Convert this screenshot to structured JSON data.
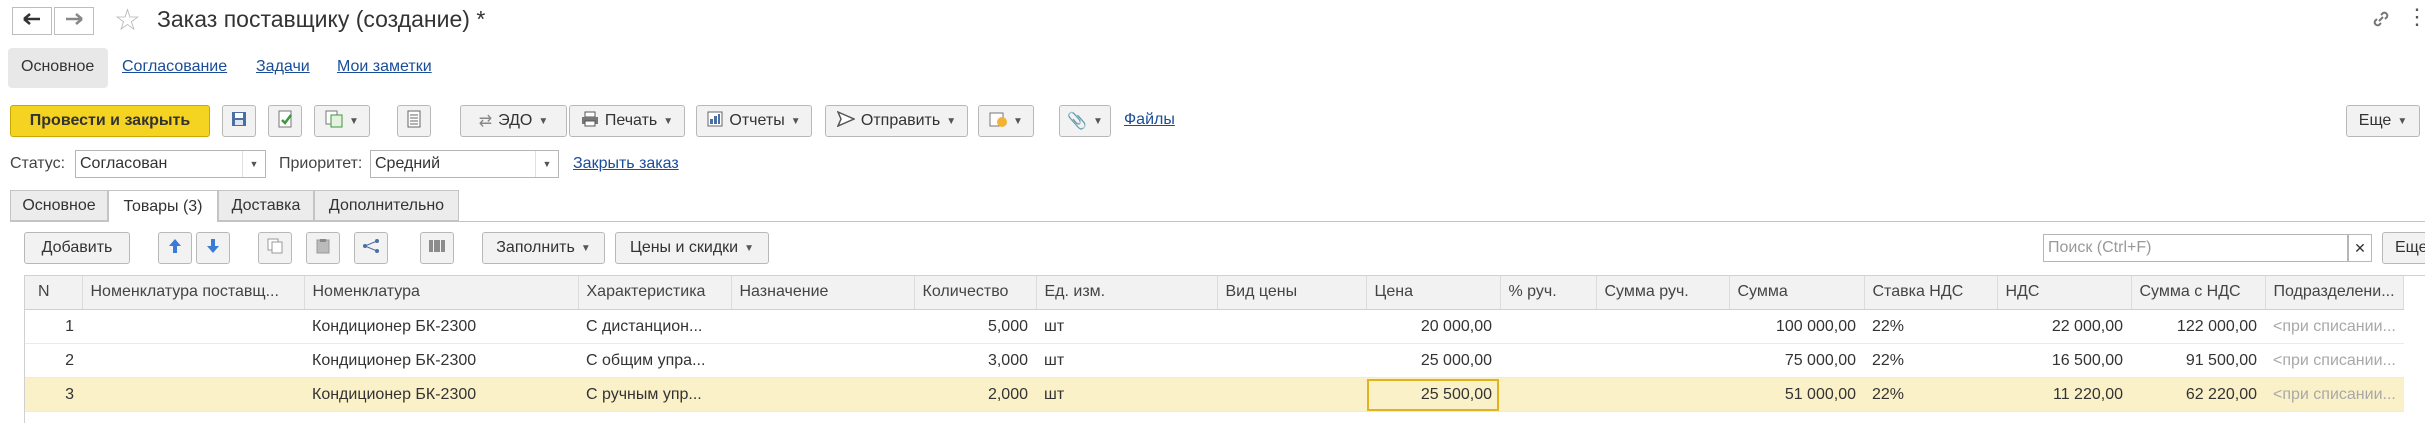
{
  "window": {
    "title": "Заказ поставщику (создание) *"
  },
  "top_tabs": [
    "Основное",
    "Согласование",
    "Задачи",
    "Мои заметки"
  ],
  "toolbar": {
    "post_close": "Провести и закрыть",
    "edo": "ЭДО",
    "print": "Печать",
    "reports": "Отчеты",
    "send": "Отправить",
    "files": "Файлы",
    "more": "Еще"
  },
  "fields": {
    "status_label": "Статус:",
    "status_value": "Согласован",
    "priority_label": "Приоритет:",
    "priority_value": "Средний",
    "close_order": "Закрыть заказ"
  },
  "form_tabs": [
    "Основное",
    "Товары (3)",
    "Доставка",
    "Дополнительно"
  ],
  "goods_toolbar": {
    "add": "Добавить",
    "fill": "Заполнить",
    "prices": "Цены и скидки",
    "search_placeholder": "Поиск (Ctrl+F)",
    "more": "Еще"
  },
  "table": {
    "columns": [
      "N",
      "Номенклатура поставщ...",
      "Номенклатура",
      "Характеристика",
      "Назначение",
      "Количество",
      "Ед. изм.",
      "Вид цены",
      "Цена",
      "% руч.",
      "Сумма руч.",
      "Сумма",
      "Ставка НДС",
      "НДС",
      "Сумма с НДС",
      "Подразделени..."
    ],
    "rows": [
      {
        "n": "1",
        "supplier_item": "",
        "item": "Кондиционер БК-2300",
        "characteristic": "С дистанцион...",
        "purpose": "",
        "qty": "5,000",
        "unit": "шт",
        "price_type": "",
        "price": "20 000,00",
        "pct": "",
        "manual_sum": "",
        "sum": "100 000,00",
        "vat_rate": "22%",
        "vat": "22 000,00",
        "sum_vat": "122 000,00",
        "dept": "<при списании..."
      },
      {
        "n": "2",
        "supplier_item": "",
        "item": "Кондиционер БК-2300",
        "characteristic": "С общим упра...",
        "purpose": "",
        "qty": "3,000",
        "unit": "шт",
        "price_type": "",
        "price": "25 000,00",
        "pct": "",
        "manual_sum": "",
        "sum": "75 000,00",
        "vat_rate": "22%",
        "vat": "16 500,00",
        "sum_vat": "91 500,00",
        "dept": "<при списании..."
      },
      {
        "n": "3",
        "supplier_item": "",
        "item": "Кондиционер БК-2300",
        "characteristic": "С ручным упр...",
        "purpose": "",
        "qty": "2,000",
        "unit": "шт",
        "price_type": "",
        "price": "25 500,00",
        "pct": "",
        "manual_sum": "",
        "sum": "51 000,00",
        "vat_rate": "22%",
        "vat": "11 220,00",
        "sum_vat": "62 220,00",
        "dept": "<при списании..."
      }
    ]
  },
  "colors": {
    "accent_button": "#f5d321",
    "link": "#1a4d99",
    "selected_row": "#fbf1c8"
  }
}
